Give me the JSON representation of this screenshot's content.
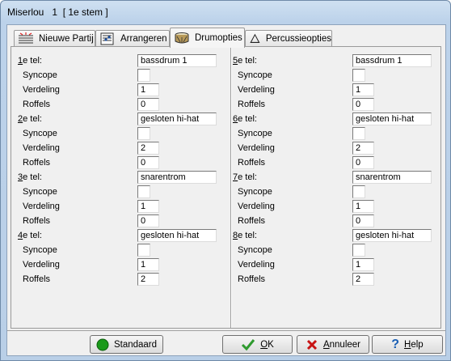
{
  "window": {
    "title": "Miserlou   1  [ 1e stem ]"
  },
  "tabs": [
    {
      "label": "Nieuwe Partij",
      "icon": "staff-lines-icon"
    },
    {
      "label": "Arrangeren",
      "icon": "score-icon"
    },
    {
      "label": "Drumopties",
      "icon": "drum-icon",
      "active": true
    },
    {
      "label": "Percussieopties",
      "icon": "triangle-icon"
    }
  ],
  "sub_labels": {
    "syncope": "Syncope",
    "verdeling": "Verdeling",
    "roffels": "Roffels"
  },
  "beats": [
    {
      "prefix": "1",
      "suffix": "e tel:",
      "sound": "bassdrum 1",
      "syncope": "",
      "verdeling": "1",
      "roffels": "0"
    },
    {
      "prefix": "2",
      "suffix": "e tel:",
      "sound": "gesloten hi-hat",
      "syncope": "",
      "verdeling": "2",
      "roffels": "0"
    },
    {
      "prefix": "3",
      "suffix": "e tel:",
      "sound": "snarentrom",
      "syncope": "",
      "verdeling": "1",
      "roffels": "0"
    },
    {
      "prefix": "4",
      "suffix": "e tel:",
      "sound": "gesloten hi-hat",
      "syncope": "",
      "verdeling": "1",
      "roffels": "2"
    },
    {
      "prefix": "5",
      "suffix": "e tel:",
      "sound": "bassdrum 1",
      "syncope": "",
      "verdeling": "1",
      "roffels": "0"
    },
    {
      "prefix": "6",
      "suffix": "e tel:",
      "sound": "gesloten hi-hat",
      "syncope": "",
      "verdeling": "2",
      "roffels": "0"
    },
    {
      "prefix": "7",
      "suffix": "e tel:",
      "sound": "snarentrom",
      "syncope": "",
      "verdeling": "1",
      "roffels": "0"
    },
    {
      "prefix": "8",
      "suffix": "e tel:",
      "sound": "gesloten hi-hat",
      "syncope": "",
      "verdeling": "1",
      "roffels": "2"
    }
  ],
  "buttons": {
    "standaard": {
      "label": "Standaard",
      "color": "#1a9a1a"
    },
    "ok": {
      "label_ul": "O",
      "label_rest": "K",
      "color": "#2e9a2e"
    },
    "annuleer": {
      "label_ul": "A",
      "label_rest": "nnuleer",
      "color": "#c81414"
    },
    "help": {
      "label_ul": "H",
      "label_rest": "elp",
      "color": "#1a5fb4"
    }
  }
}
